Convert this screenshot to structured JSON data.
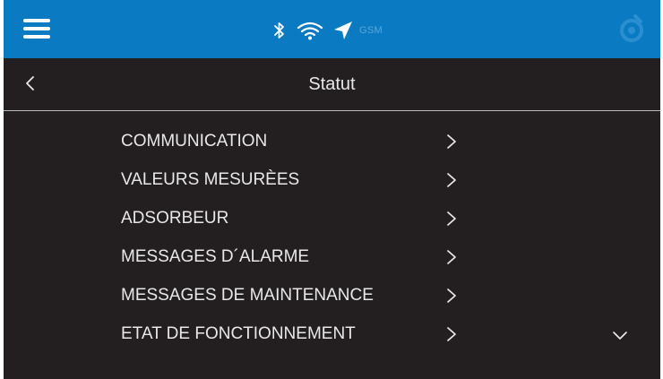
{
  "topbar": {
    "menu_icon": "hamburger-icon",
    "status_icons": [
      "bluetooth-icon",
      "wifi-icon",
      "location-arrow-icon"
    ],
    "gsm_label": "GSM",
    "logo_icon": "brand-logo-icon",
    "colors": {
      "background": "#0a7bc2",
      "status_icon": "#6fb3e0"
    }
  },
  "header": {
    "back_icon": "chevron-left-icon",
    "title": "Statut"
  },
  "menu": {
    "items": [
      {
        "label": "COMMUNICATION"
      },
      {
        "label": "VALEURS MESURÈES"
      },
      {
        "label": "ADSORBEUR"
      },
      {
        "label": "MESSAGES D´ALARME"
      },
      {
        "label": "MESSAGES DE MAINTENANCE"
      },
      {
        "label": "ETAT DE FONCTIONNEMENT"
      }
    ],
    "item_icon": "chevron-right-icon"
  },
  "scroll": {
    "icon": "chevron-down-icon"
  },
  "theme": {
    "background": "#231f20",
    "text": "#e8e8e8"
  }
}
